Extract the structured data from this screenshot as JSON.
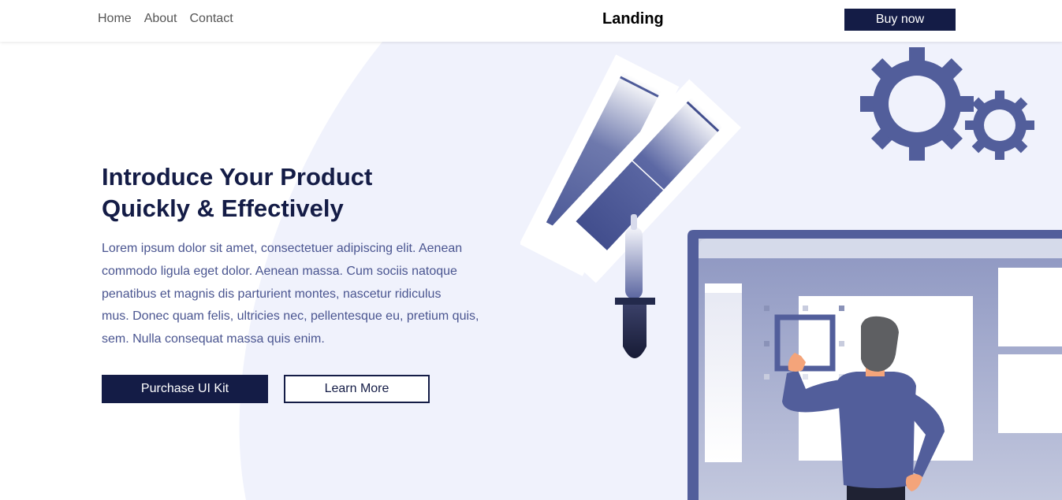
{
  "nav": {
    "links": [
      "Home",
      "About",
      "Contact"
    ],
    "brand": "Landing",
    "cta": "Buy now"
  },
  "hero": {
    "title_line1": "Introduce Your Product",
    "title_line2": "Quickly & Effectively",
    "body": [
      "Lorem ipsum dolor sit amet, consectetuer adipiscing elit. Aenean",
      "commodo ligula eget dolor. Aenean massa. Cum sociis natoque",
      "penatibus et magnis dis parturient montes, nascetur ridiculus",
      "mus. Donec quam felis, ultricies nec, pellentesque eu, pretium quis,",
      "sem. Nulla consequat massa quis enim."
    ],
    "primary_button": "Purchase UI Kit",
    "secondary_button": "Learn More"
  },
  "colors": {
    "brand_navy": "#141c46",
    "accent_blue": "#525e9b",
    "background_tint": "#f0f2fc",
    "text_muted": "#4a5590"
  },
  "illustration": {
    "icons": [
      "color-swatch-icon",
      "dropper-icon",
      "large-gear-icon",
      "small-gear-icon",
      "monitor-icon",
      "person-figure"
    ]
  }
}
